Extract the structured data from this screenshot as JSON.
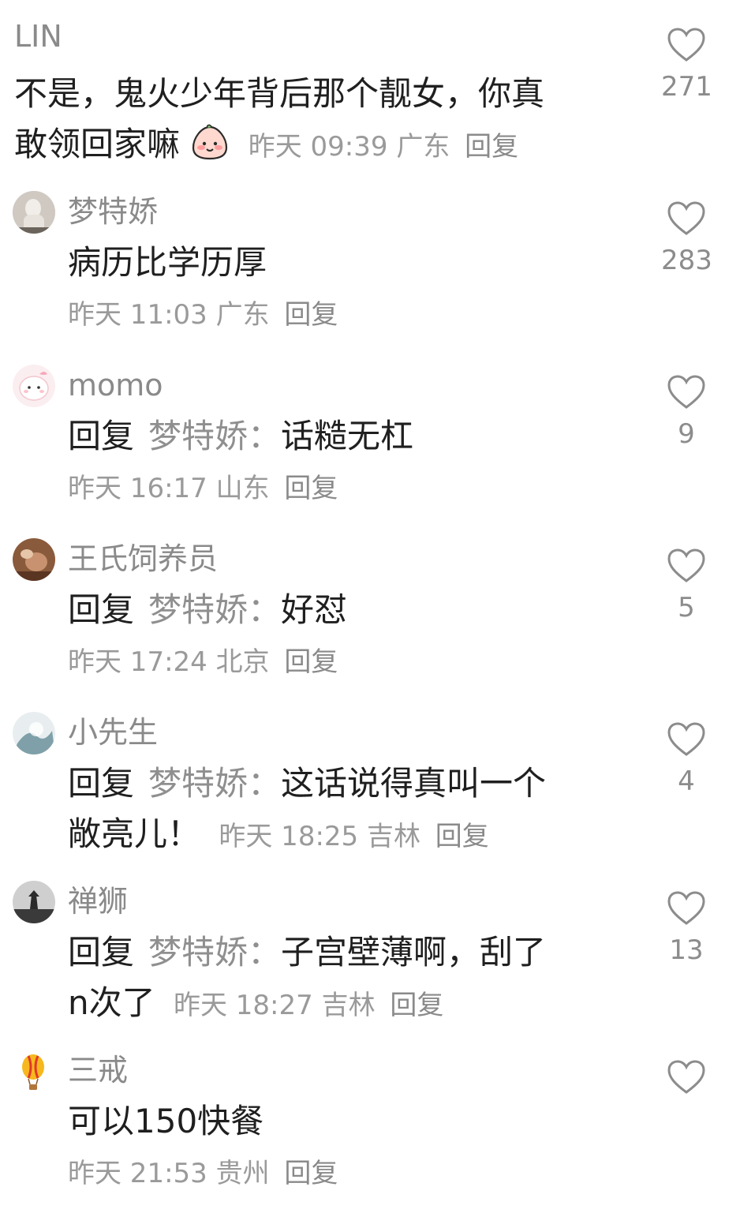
{
  "comments": [
    {
      "username": "LIN",
      "line1": "不是，鬼火少年背后那个靓女，你真",
      "line2": "敢领回家嘛",
      "emoji": "blushing-face-emoji",
      "time": "昨天 09:39",
      "location": "广东",
      "reply_label": "回复",
      "likes": "271"
    },
    {
      "username": "梦特娇",
      "text": "病历比学历厚",
      "time": "昨天 11:03",
      "location": "广东",
      "reply_label": "回复",
      "likes": "283"
    },
    {
      "username": "momo",
      "reply_prefix": "回复",
      "reply_target": "梦特娇：",
      "text": "话糙无杠",
      "time": "昨天 16:17",
      "location": "山东",
      "reply_label": "回复",
      "likes": "9"
    },
    {
      "username": "王氏饲养员",
      "reply_prefix": "回复",
      "reply_target": "梦特娇：",
      "text": "好怼",
      "time": "昨天 17:24",
      "location": "北京",
      "reply_label": "回复",
      "likes": "5"
    },
    {
      "username": "小先生",
      "reply_prefix": "回复",
      "reply_target": "梦特娇：",
      "text": "这话说得真叫一个",
      "line2": "敞亮儿！",
      "time": "昨天 18:25",
      "location": "吉林",
      "reply_label": "回复",
      "likes": "4"
    },
    {
      "username": "禅狮",
      "reply_prefix": "回复",
      "reply_target": "梦特娇：",
      "text": "子宫壁薄啊，刮了",
      "line2": "n次了",
      "time": "昨天 18:27",
      "location": "吉林",
      "reply_label": "回复",
      "likes": "13"
    },
    {
      "username": "三戒",
      "text": "可以150快餐",
      "time": "昨天 21:53",
      "location": "贵州",
      "reply_label": "回复",
      "likes": ""
    }
  ],
  "colors": {
    "text": "#1f1f1f",
    "meta": "#9a9a9a",
    "username": "#8a8a8a",
    "heart_stroke": "#8c8c8c"
  },
  "icons": {
    "like": "heart-outline-icon",
    "avatar_balloon": "hot-air-balloon-icon"
  }
}
